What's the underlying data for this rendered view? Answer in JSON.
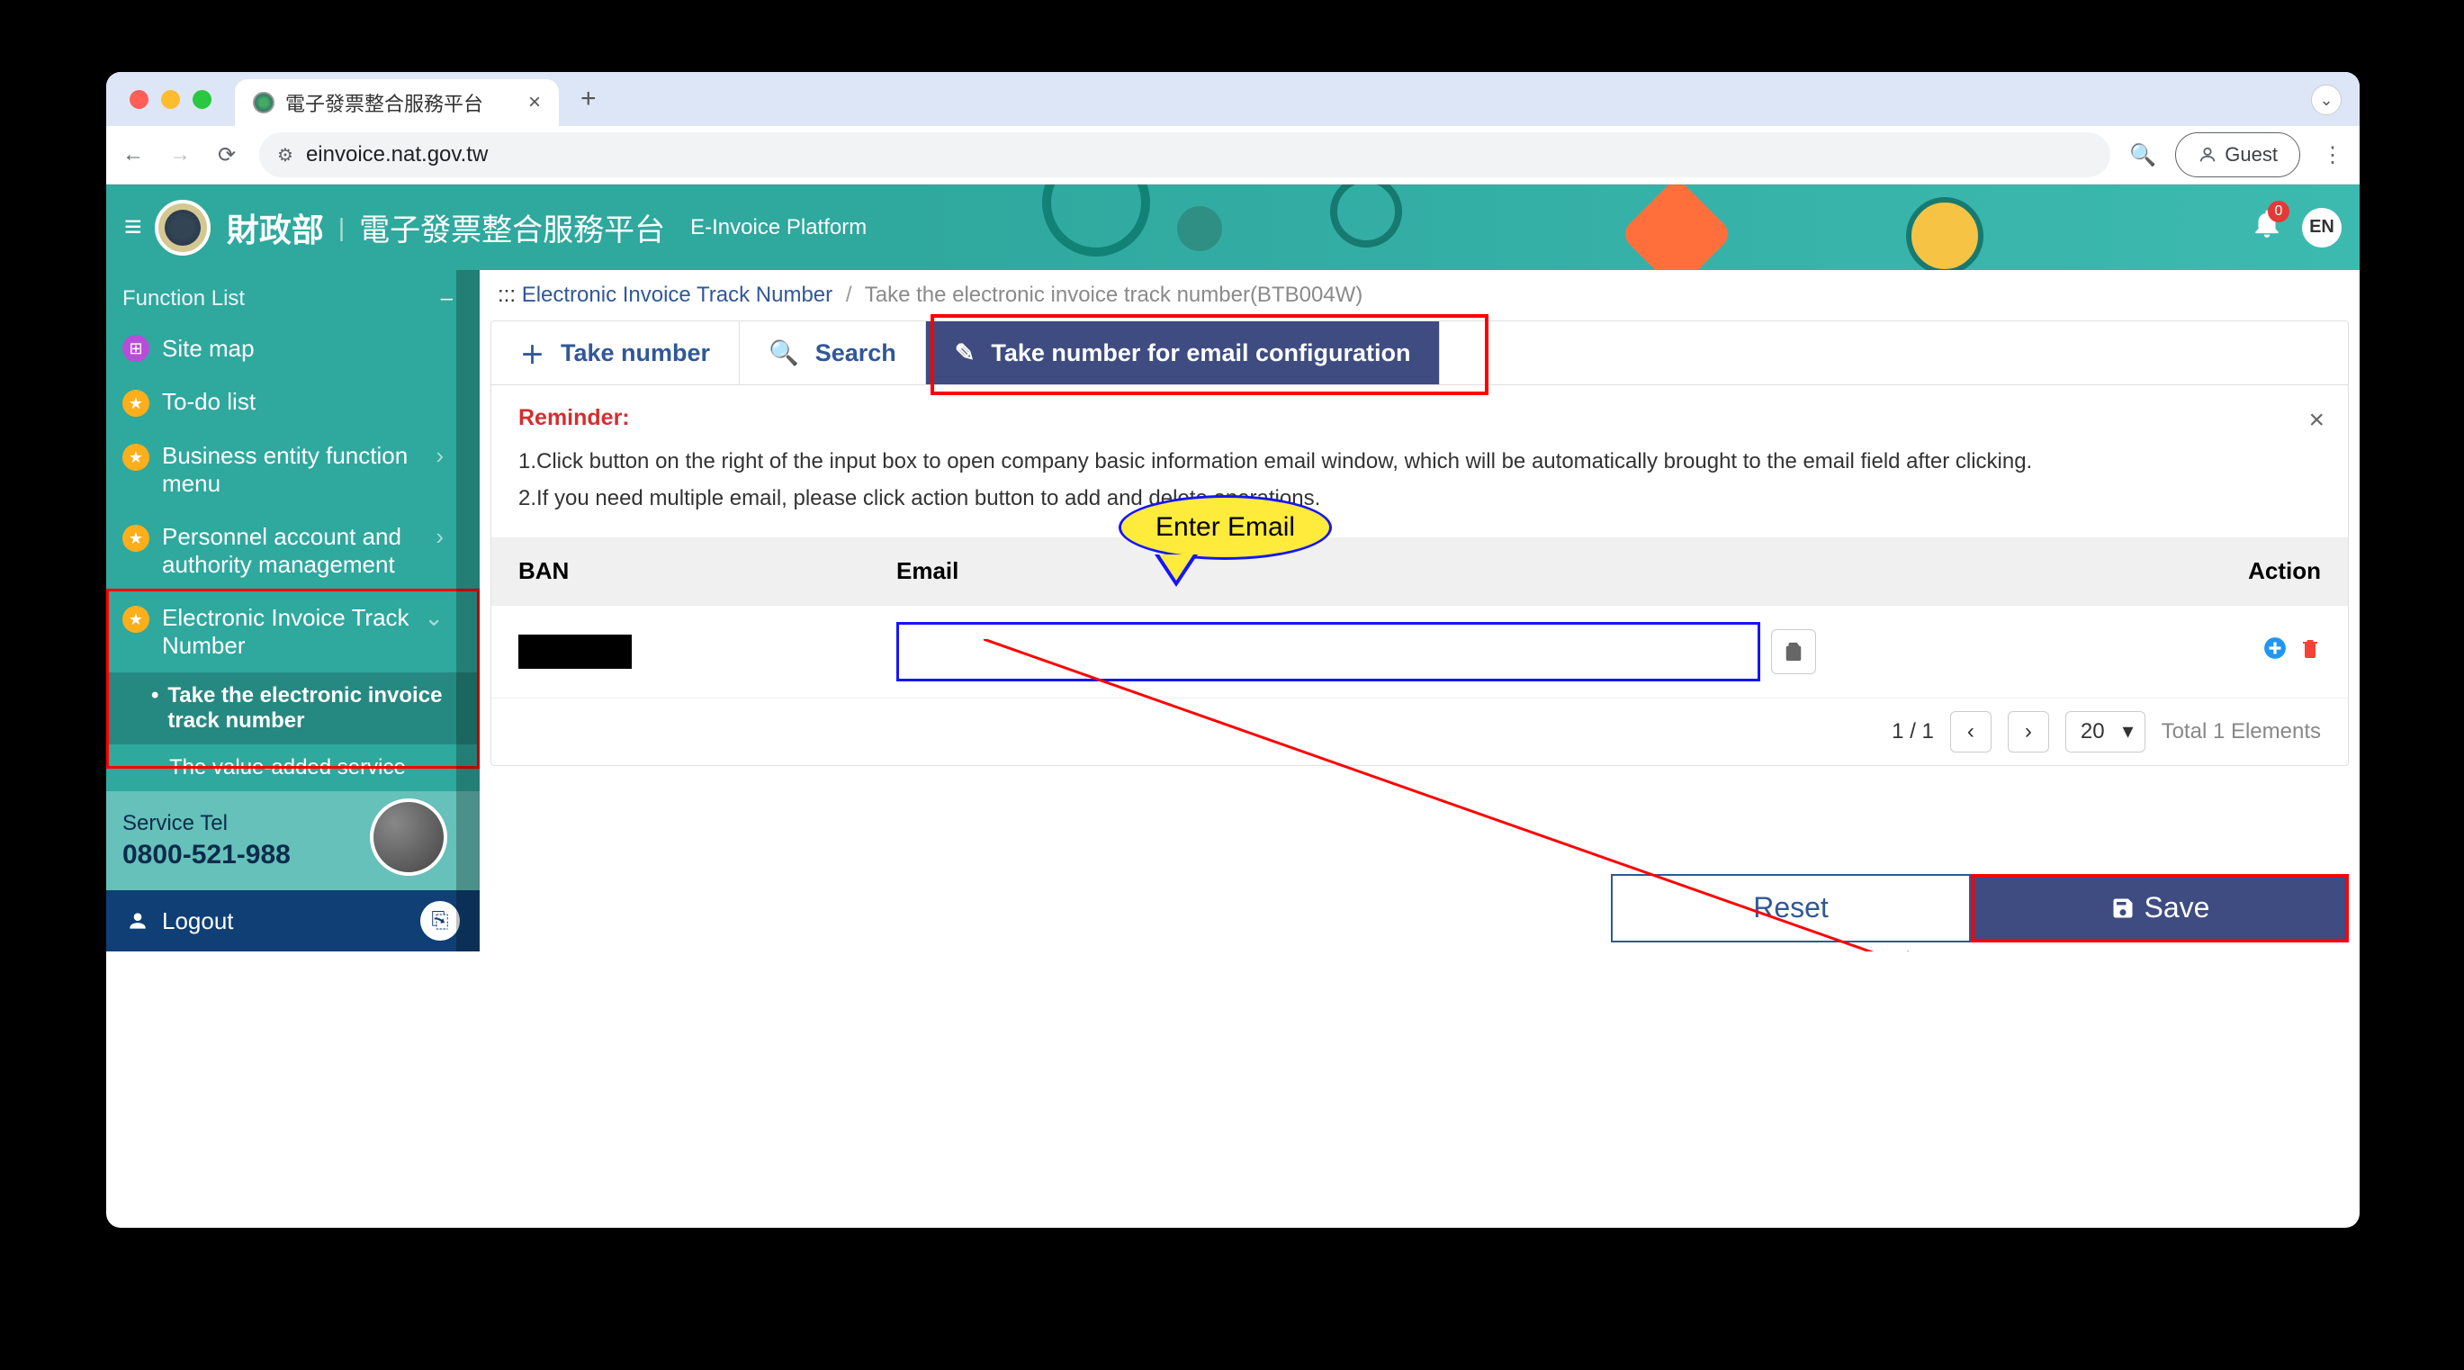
{
  "browser": {
    "tab_title": "電子發票整合服務平台",
    "url": "einvoice.nat.gov.tw",
    "guest_label": "Guest"
  },
  "header": {
    "org": "財政部",
    "title_zh": "電子發票整合服務平台",
    "title_en": "E-Invoice Platform",
    "badge_count": "0",
    "lang": "EN"
  },
  "sidebar": {
    "heading": "Function List",
    "items": [
      "Site map",
      "To-do list",
      "Business entity function menu",
      "Personnel account and authority management",
      "Electronic Invoice Track Number"
    ],
    "sub_active": "Take the electronic invoice track number",
    "sub_next": "The value-added service",
    "service_label": "Service Tel",
    "service_phone": "0800-521-988",
    "logout": "Logout"
  },
  "crumbs": {
    "prefix": ":::",
    "link": "Electronic Invoice Track Number",
    "current": "Take the electronic invoice track number(BTB004W)"
  },
  "tabs": {
    "take": "Take number",
    "search": "Search",
    "email": "Take number for email configuration"
  },
  "reminder": {
    "title": "Reminder:",
    "line1": "1.Click button on the right of the input box to open company basic information email window, which will be automatically brought to the email field after clicking.",
    "line2": "2.If you need multiple email, please click action button to add and delete operations."
  },
  "table": {
    "col_ban": "BAN",
    "col_email": "Email",
    "col_action": "Action"
  },
  "pager": {
    "pos": "1 / 1",
    "size": "20",
    "total": "Total 1 Elements"
  },
  "buttons": {
    "reset": "Reset",
    "save": "Save"
  },
  "callout": {
    "text": "Enter Email"
  }
}
